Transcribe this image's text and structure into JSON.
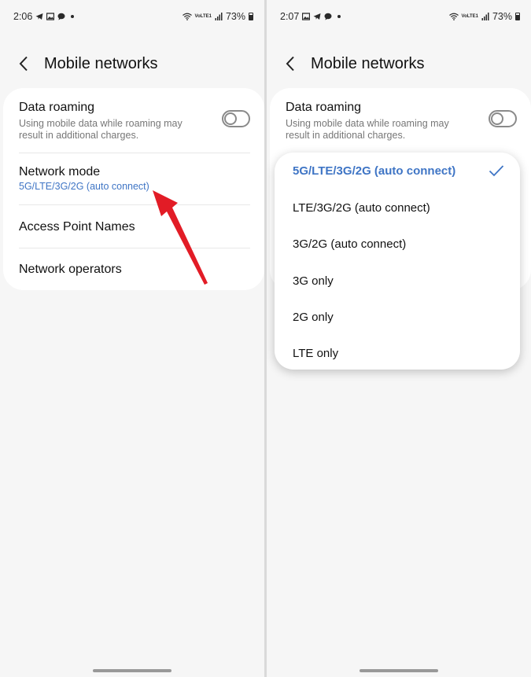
{
  "left_screen": {
    "status": {
      "time": "2:06",
      "volte_label": "VoLTE1",
      "battery": "73%"
    },
    "title": "Mobile networks",
    "data_roaming": {
      "title": "Data roaming",
      "subtitle": "Using mobile data while roaming may result in additional charges.",
      "toggle_on": false
    },
    "network_mode": {
      "title": "Network mode",
      "value": "5G/LTE/3G/2G (auto connect)"
    },
    "access_point_names": "Access Point Names",
    "network_operators": "Network operators"
  },
  "right_screen": {
    "status": {
      "time": "2:07",
      "volte_label": "VoLTE1",
      "battery": "73%"
    },
    "title": "Mobile networks",
    "data_roaming": {
      "title": "Data roaming",
      "subtitle": "Using mobile data while roaming may result in additional charges.",
      "toggle_on": false
    },
    "network_mode_options": [
      {
        "label": "5G/LTE/3G/2G (auto connect)",
        "selected": true
      },
      {
        "label": "LTE/3G/2G (auto connect)",
        "selected": false
      },
      {
        "label": "3G/2G (auto connect)",
        "selected": false
      },
      {
        "label": "3G only",
        "selected": false
      },
      {
        "label": "2G only",
        "selected": false
      },
      {
        "label": "LTE only",
        "selected": false
      }
    ]
  },
  "colors": {
    "accent": "#3f75c5",
    "annotation_arrow": "#e21c26",
    "background": "#f6f6f6",
    "card": "#ffffff"
  }
}
